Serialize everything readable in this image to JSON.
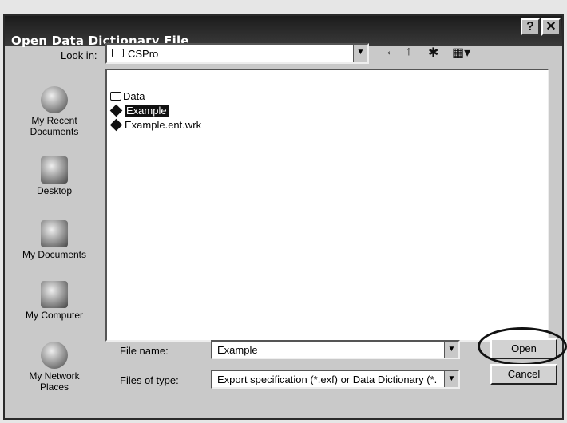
{
  "window": {
    "title": "Open Data Dictionary File",
    "help_glyph": "?",
    "close_glyph": "✕"
  },
  "lookin": {
    "label": "Look in:",
    "value": "CSPro"
  },
  "toolbar": {
    "back": "←",
    "up": "↑",
    "new_folder": "✱",
    "views": "▦▾"
  },
  "places": [
    {
      "label": "My Recent\nDocuments",
      "icon": "recent-documents-icon"
    },
    {
      "label": "Desktop",
      "icon": "desktop-icon"
    },
    {
      "label": "My Documents",
      "icon": "my-documents-icon"
    },
    {
      "label": "My Computer",
      "icon": "my-computer-icon"
    },
    {
      "label": "My Network\nPlaces",
      "icon": "network-places-icon"
    }
  ],
  "files": [
    {
      "name": "Data",
      "type": "folder"
    },
    {
      "name": "Example",
      "type": "dictionary",
      "selected": true
    },
    {
      "name": "Example.ent.wrk",
      "type": "dictionary"
    }
  ],
  "filename": {
    "label": "File name:",
    "value": "Example"
  },
  "filetype": {
    "label": "Files of type:",
    "value": "Export specification (*.exf) or Data Dictionary (*."
  },
  "buttons": {
    "open": "Open",
    "cancel": "Cancel"
  }
}
